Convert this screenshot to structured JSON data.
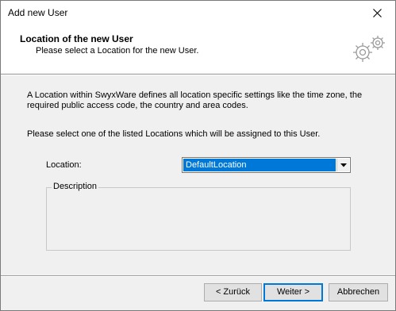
{
  "window": {
    "title": "Add new User"
  },
  "header": {
    "title": "Location of the new User",
    "subtitle": "Please select a Location for the new User.",
    "icon": "gears-icon"
  },
  "body": {
    "intro": "A Location within SwyxWare defines all location specific settings like the time zone, the required public access code, the country and area codes.",
    "instruction": "Please select one of the listed Locations which will be assigned to this User.",
    "location_label": "Location:",
    "location_value": "DefaultLocation",
    "description_label": "Description"
  },
  "buttons": {
    "back": "< Zurück",
    "next": "Weiter >",
    "cancel": "Abbrechen"
  },
  "colors": {
    "selection": "#0078d7",
    "default_button_border": "#0078d7"
  }
}
